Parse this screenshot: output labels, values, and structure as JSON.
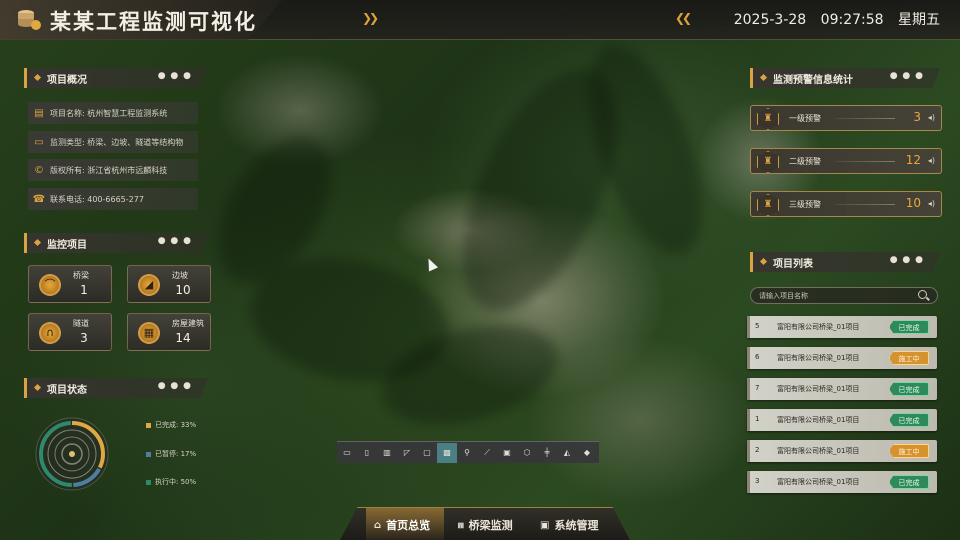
{
  "header": {
    "title": "某某工程监测可视化",
    "date": "2025-3-28",
    "time": "09:27:58",
    "weekday": "星期五"
  },
  "overview": {
    "title": "项目概况",
    "rows": [
      {
        "icon": "document-icon",
        "text": "项目名称: 杭州智慧工程监测系统"
      },
      {
        "icon": "monitor-icon",
        "text": "监测类型: 桥梁、边坡、隧道等结构物"
      },
      {
        "icon": "copyright-icon",
        "text": "版权所有: 浙江省杭州市远麟科技"
      },
      {
        "icon": "phone-icon",
        "text": "联系电话: 400-6665-277"
      }
    ]
  },
  "monitor": {
    "title": "监控项目",
    "items": [
      {
        "name": "桥梁",
        "count": "1",
        "icon": "bridge-icon"
      },
      {
        "name": "边坡",
        "count": "10",
        "icon": "slope-icon"
      },
      {
        "name": "隧道",
        "count": "3",
        "icon": "tunnel-icon"
      },
      {
        "name": "房屋建筑",
        "count": "14",
        "icon": "building-icon"
      }
    ]
  },
  "status": {
    "title": "项目状态",
    "legend": [
      {
        "label": "已完成: 33%",
        "color": "#e0a842",
        "value": 33
      },
      {
        "label": "已暂停: 17%",
        "color": "#4f7fa0",
        "value": 17
      },
      {
        "label": "执行中: 50%",
        "color": "#2e8a6a",
        "value": 50
      }
    ]
  },
  "alarms": {
    "title": "监测预警信息统计",
    "items": [
      {
        "name": "一级预警",
        "value": "3"
      },
      {
        "name": "二级预警",
        "value": "12"
      },
      {
        "name": "三级预警",
        "value": "10"
      }
    ]
  },
  "projects": {
    "title": "项目列表",
    "search_placeholder": "请输入项目名称",
    "rows": [
      {
        "no": "5",
        "name": "富阳有限公司桥梁_01项目",
        "status": "已完成",
        "kind": "done"
      },
      {
        "no": "6",
        "name": "富阳有限公司桥梁_01项目",
        "status": "施工中",
        "kind": "work"
      },
      {
        "no": "7",
        "name": "富阳有限公司桥梁_01项目",
        "status": "已完成",
        "kind": "done"
      },
      {
        "no": "1",
        "name": "富阳有限公司桥梁_01项目",
        "status": "已完成",
        "kind": "done"
      },
      {
        "no": "2",
        "name": "富阳有限公司桥梁_01项目",
        "status": "施工中",
        "kind": "work"
      },
      {
        "no": "3",
        "name": "富阳有限公司桥梁_01项目",
        "status": "已完成",
        "kind": "done"
      }
    ]
  },
  "toolbar": {
    "tools": [
      "ruler-icon",
      "vertical-ruler-icon",
      "bridge-tool-icon",
      "angle-icon",
      "rectangle-icon",
      "area-icon",
      "pin-icon",
      "line-chart-icon",
      "box-icon",
      "polygon-icon",
      "elevation-icon",
      "profile-icon",
      "eraser-icon"
    ],
    "active_index": 5
  },
  "bottom_nav": {
    "tabs": [
      {
        "label": "首页总览",
        "icon": "home-icon"
      },
      {
        "label": "桥梁监测",
        "icon": "bridge-nav-icon"
      },
      {
        "label": "系统管理",
        "icon": "settings-icon"
      }
    ],
    "active_index": 0
  }
}
